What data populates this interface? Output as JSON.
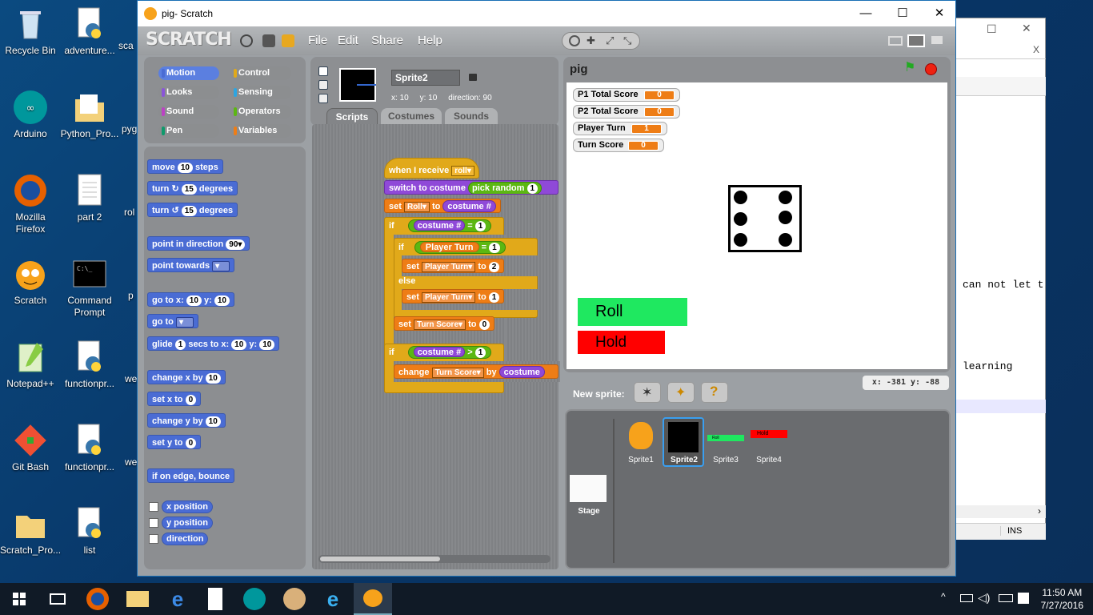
{
  "desktop": {
    "icons": [
      {
        "label": "Recycle Bin"
      },
      {
        "label": "adventure..."
      },
      {
        "label": "sca"
      },
      {
        "label": "Arduino"
      },
      {
        "label": "Python_Pro..."
      },
      {
        "label": "pyg"
      },
      {
        "label": "Mozilla Firefox"
      },
      {
        "label": "part 2"
      },
      {
        "label": "rol"
      },
      {
        "label": "Scratch"
      },
      {
        "label": "Command Prompt"
      },
      {
        "label": "p"
      },
      {
        "label": "Notepad++"
      },
      {
        "label": "functionpr..."
      },
      {
        "label": "we"
      },
      {
        "label": "Git Bash"
      },
      {
        "label": "functionpr..."
      },
      {
        "label": "we"
      },
      {
        "label": "Scratch_Pro..."
      },
      {
        "label": "list"
      }
    ]
  },
  "bg_window": {
    "close": "X",
    "lines": [
      "can not let t",
      "learning"
    ],
    "status": "INS"
  },
  "window": {
    "title": "pig- Scratch",
    "minimize": "—",
    "maximize": "☐",
    "close": "✕"
  },
  "scratch": {
    "logo": "SCRATCH",
    "menu": [
      "File",
      "Edit",
      "Share",
      "Help"
    ],
    "categories": [
      {
        "label": "Motion",
        "color": "#4a6cd4"
      },
      {
        "label": "Control",
        "color": "#e1a91a"
      },
      {
        "label": "Looks",
        "color": "#8a55d7"
      },
      {
        "label": "Sensing",
        "color": "#2ca5e2"
      },
      {
        "label": "Sound",
        "color": "#bb42c3"
      },
      {
        "label": "Operators",
        "color": "#5cb712"
      },
      {
        "label": "Pen",
        "color": "#0e9a6c"
      },
      {
        "label": "Variables",
        "color": "#ee7d16"
      }
    ],
    "palette": {
      "move": "move",
      "move_val": "10",
      "move_unit": "steps",
      "turn_r": "turn",
      "turn_r_val": "15",
      "turn_r_unit": "degrees",
      "turn_l": "turn",
      "turn_l_val": "15",
      "turn_l_unit": "degrees",
      "point_dir": "point in direction",
      "point_dir_val": "90",
      "point_towards": "point towards",
      "goto_xy": "go to x:",
      "goto_x": "10",
      "goto_y_lbl": "y:",
      "goto_y": "10",
      "goto": "go to",
      "glide": "glide",
      "glide_secs": "1",
      "glide_mid": "secs to x:",
      "glide_x": "10",
      "glide_y_lbl": "y:",
      "glide_y": "10",
      "change_x": "change x by",
      "change_x_val": "10",
      "set_x": "set x to",
      "set_x_val": "0",
      "change_y": "change y by",
      "change_y_val": "10",
      "set_y": "set y to",
      "set_y_val": "0",
      "bounce": "if on edge, bounce",
      "x_pos": "x position",
      "y_pos": "y position",
      "direction": "direction"
    },
    "sprite": {
      "name": "Sprite2",
      "x_label": "x:",
      "x": "10",
      "y_label": "y:",
      "y": "10",
      "dir_label": "direction:",
      "dir": "90"
    },
    "tabs": [
      "Scripts",
      "Costumes",
      "Sounds"
    ],
    "script": {
      "hat": "when I receive",
      "hat_msg": "roll",
      "switch": "switch to costume",
      "pick": "pick random",
      "pick_val": "1",
      "set1": "set",
      "set1_var": "Roll",
      "set1_to": "to",
      "set1_rep": "costume #",
      "if1": "if",
      "if1_rep": "costume #",
      "if1_op": "=",
      "if1_val": "1",
      "if2": "if",
      "if2_var": "Player Turn",
      "if2_op": "=",
      "if2_val": "1",
      "set2": "set",
      "set2_var": "Player Turn",
      "set2_to": "to",
      "set2_val": "2",
      "else": "else",
      "set3": "set",
      "set3_var": "Player Turn",
      "set3_to": "to",
      "set3_val": "1",
      "set4": "set",
      "set4_var": "Turn Score",
      "set4_to": "to",
      "set4_val": "0",
      "if3": "if",
      "if3_rep": "costume #",
      "if3_op": ">",
      "if3_val": "1",
      "change": "change",
      "change_var": "Turn Score",
      "change_by": "by",
      "change_rep": "costume"
    },
    "stage": {
      "title": "pig",
      "monitors": [
        {
          "label": "P1 Total Score",
          "value": "0"
        },
        {
          "label": "P2 Total Score",
          "value": "0"
        },
        {
          "label": "Player Turn",
          "value": "1"
        },
        {
          "label": "Turn Score",
          "value": "0"
        }
      ],
      "roll": "Roll",
      "hold": "Hold",
      "coords": "x: -381   y: -88"
    },
    "sprites_pane": {
      "new_sprite": "New sprite:",
      "stage_label": "Stage",
      "sprites": [
        "Sprite1",
        "Sprite2",
        "Sprite3",
        "Sprite4"
      ],
      "mini_roll": "Roll",
      "mini_hold": "Hold"
    }
  },
  "taskbar": {
    "time": "11:50 AM",
    "date": "7/27/2016"
  }
}
